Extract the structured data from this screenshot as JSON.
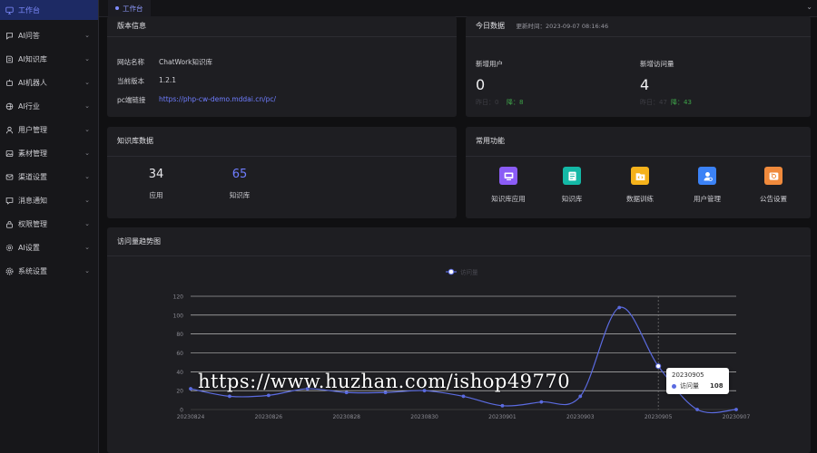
{
  "sidebar": {
    "items": [
      {
        "label": "工作台",
        "icon": "monitor-icon",
        "active": true
      },
      {
        "label": "AI问答",
        "icon": "chat-icon"
      },
      {
        "label": "AI知识库",
        "icon": "book-icon"
      },
      {
        "label": "AI机器人",
        "icon": "robot-icon"
      },
      {
        "label": "AI行业",
        "icon": "globe-icon"
      },
      {
        "label": "用户管理",
        "icon": "user-icon"
      },
      {
        "label": "素材管理",
        "icon": "image-icon"
      },
      {
        "label": "渠道设置",
        "icon": "mail-icon"
      },
      {
        "label": "消息通知",
        "icon": "message-icon"
      },
      {
        "label": "权限管理",
        "icon": "lock-icon"
      },
      {
        "label": "AI设置",
        "icon": "settings-icon"
      },
      {
        "label": "系统设置",
        "icon": "gear-icon"
      }
    ]
  },
  "topbar": {
    "active_tab": "工作台"
  },
  "version_card": {
    "title": "版本信息",
    "rows": [
      {
        "label": "网站名称",
        "value": "ChatWork知识库"
      },
      {
        "label": "当前版本",
        "value": "1.2.1"
      },
      {
        "label": "pc端链接",
        "value": "https://php-cw-demo.mddai.cn/pc/"
      }
    ]
  },
  "today_card": {
    "title": "今日数据",
    "update_time": "更新时间：2023-09-07 08:16:46",
    "stats": [
      {
        "label": "新增用户",
        "value": "0",
        "sub": "昨日：0",
        "down": "降：8"
      },
      {
        "label": "新增访问量",
        "value": "4",
        "sub": "昨日：47",
        "down": "降：43"
      }
    ]
  },
  "kb_card": {
    "title": "知识库数据",
    "items": [
      {
        "value": "34",
        "label": "应用"
      },
      {
        "value": "65",
        "label": "知识库"
      }
    ]
  },
  "functions_card": {
    "title": "常用功能",
    "items": [
      {
        "label": "知识库应用",
        "icon": "app-icon",
        "color": "#8b5cf6"
      },
      {
        "label": "知识库",
        "icon": "notebook-icon",
        "color": "#14b8a6"
      },
      {
        "label": "数据训练",
        "icon": "code-folder-icon",
        "color": "#f5b21b"
      },
      {
        "label": "用户管理",
        "icon": "user-manage-icon",
        "color": "#3b82f6"
      },
      {
        "label": "公告设置",
        "icon": "announcement-icon",
        "color": "#f08a3c"
      }
    ]
  },
  "trend_card": {
    "title": "访问量趋势图"
  },
  "chart_data": {
    "type": "line",
    "title": "",
    "legend": [
      "访问量"
    ],
    "x": [
      "20230824",
      "20230825",
      "20230826",
      "20230827",
      "20230828",
      "20230829",
      "20230830",
      "20230831",
      "20230901",
      "20230902",
      "20230903",
      "20230904",
      "20230905",
      "20230906",
      "20230907"
    ],
    "x_tick_labels": [
      "20230824",
      "20230826",
      "20230828",
      "20230830",
      "20230901",
      "20230903",
      "20230905",
      "20230907"
    ],
    "series": [
      {
        "name": "访问量",
        "values": [
          22,
          14,
          15,
          22,
          18,
          18,
          20,
          14,
          4,
          8,
          14,
          108,
          46,
          0,
          0
        ]
      }
    ],
    "ylim": [
      0,
      120
    ],
    "yticks": [
      0,
      20,
      40,
      60,
      80,
      100,
      120
    ],
    "grid": true,
    "legend_position": "top-center",
    "color": "#5b6be0",
    "tooltip": {
      "x": "20230905",
      "series": "访问量",
      "value": "108"
    }
  },
  "watermark": "https://www.huzhan.com/ishop49770"
}
